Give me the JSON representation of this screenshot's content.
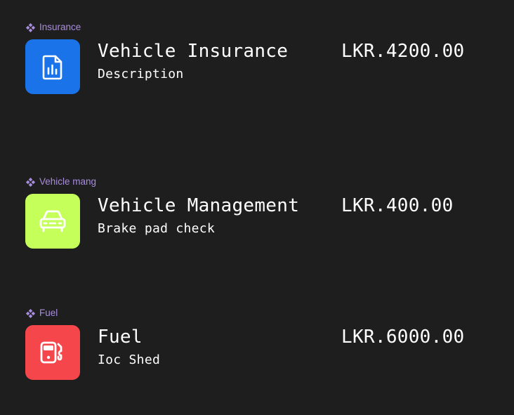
{
  "items": [
    {
      "component_label": "Insurance",
      "title": "Vehicle Insurance",
      "subtitle": "Description",
      "amount": "LKR.4200.00",
      "icon": "report-chart-icon",
      "tile_color": "#1a73e8"
    },
    {
      "component_label": "Vehicle mang",
      "title": "Vehicle Management",
      "subtitle": "Brake pad check",
      "amount": "LKR.400.00",
      "icon": "car-icon",
      "tile_color": "#c4ff5a"
    },
    {
      "component_label": "Fuel",
      "title": "Fuel",
      "subtitle": "Ioc Shed",
      "amount": "LKR.6000.00",
      "icon": "fuel-pump-icon",
      "tile_color": "#f5474b"
    }
  ]
}
